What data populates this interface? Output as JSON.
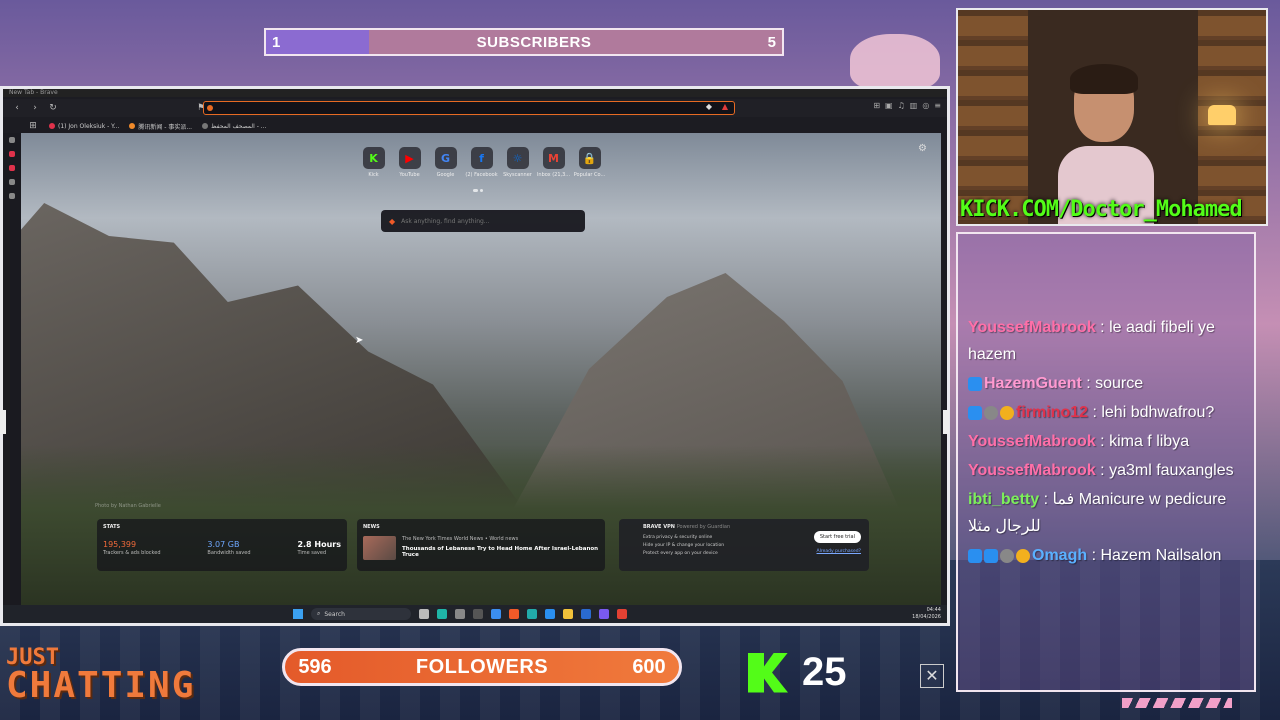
{
  "subscribers": {
    "current": "1",
    "label": "SUBSCRIBERS",
    "goal": "5",
    "progress": 0.2
  },
  "browser": {
    "title": "New Tab - Brave",
    "bookmarks": [
      {
        "label": "(1) Jon Oleksiuk - Y...",
        "color": "#e0324b"
      },
      {
        "label": "腾讯新闻 - 事实派...",
        "color": "#f08a2a"
      },
      {
        "label": "المصحف المحفظ - ...",
        "color": "#777777"
      }
    ],
    "shortcuts": [
      {
        "label": "Kick",
        "glyph": "K",
        "color": "#53fc18"
      },
      {
        "label": "YouTube",
        "glyph": "▶",
        "color": "#ff0000"
      },
      {
        "label": "Google",
        "glyph": "G",
        "color": "#4285f4"
      },
      {
        "label": "(2) Facebook",
        "glyph": "f",
        "color": "#1877f2"
      },
      {
        "label": "Skyscanner",
        "glyph": "☼",
        "color": "#0770e3"
      },
      {
        "label": "Inbox (21,3...",
        "glyph": "M",
        "color": "#ea4335"
      },
      {
        "label": "Popular Co...",
        "glyph": "🔒",
        "color": "#e0324b"
      }
    ],
    "search_placeholder": "Ask anything, find anything...",
    "photo_credit": "Photo by Nathan Gabrielle",
    "stats": {
      "title": "STATS",
      "trackers_value": "195,399",
      "trackers_label": "Trackers & ads blocked",
      "bandwidth_value": "3.07 GB",
      "bandwidth_label": "Bandwidth saved",
      "time_value": "2.8 Hours",
      "time_label": "Time saved"
    },
    "news": {
      "title": "NEWS",
      "source": "The New York Times World News  •  World news",
      "headline": "Thousands of Lebanese Try to Head Home After Israel-Lebanon Truce"
    },
    "vpn": {
      "title": "BRAVE VPN",
      "powered": "Powered by Guardian",
      "items": [
        "Extra privacy & security online",
        "Hide your IP & change your location",
        "Protect every app on your device"
      ],
      "cta": "Start free trial",
      "link": "Already purchased?"
    },
    "taskbar": {
      "search": "Search",
      "time": "04:44",
      "date": "18/04/2026"
    }
  },
  "webcam": {
    "overlay_text": "KICK.COM/Doctor_Mohamed"
  },
  "chat": {
    "messages": [
      {
        "user": "YoussefMabrook",
        "color": "#ff6fa8",
        "badges": [],
        "text": " : le aadi fibeli ye hazem"
      },
      {
        "user": "HazemGuent",
        "color": "#ff9ad0",
        "badges": [
          "blue"
        ],
        "text": " : source"
      },
      {
        "user": "firmino12",
        "color": "#e0324b",
        "badges": [
          "blue",
          "gray",
          "gold"
        ],
        "text": " : lehi bdhwafrou?"
      },
      {
        "user": "YoussefMabrook",
        "color": "#ff6fa8",
        "badges": [],
        "text": " : kima f libya"
      },
      {
        "user": "YoussefMabrook",
        "color": "#ff6fa8",
        "badges": [],
        "text": " : ya3ml fauxangles"
      },
      {
        "user": "ibti_betty",
        "color": "#7cf05a",
        "badges": [],
        "text": " : فما Manicure w pedicure للرجال مثلا"
      },
      {
        "user": "Omagh",
        "color": "#5ab0ff",
        "badges": [
          "blue",
          "blue",
          "gray",
          "gold"
        ],
        "text": " : Hazem Nailsalon"
      }
    ]
  },
  "followers": {
    "current": "596",
    "label": "FOLLOWERS",
    "goal": "600"
  },
  "category": {
    "line1": "JUST",
    "line2": "CHATTING"
  },
  "kick_viewers": "25"
}
